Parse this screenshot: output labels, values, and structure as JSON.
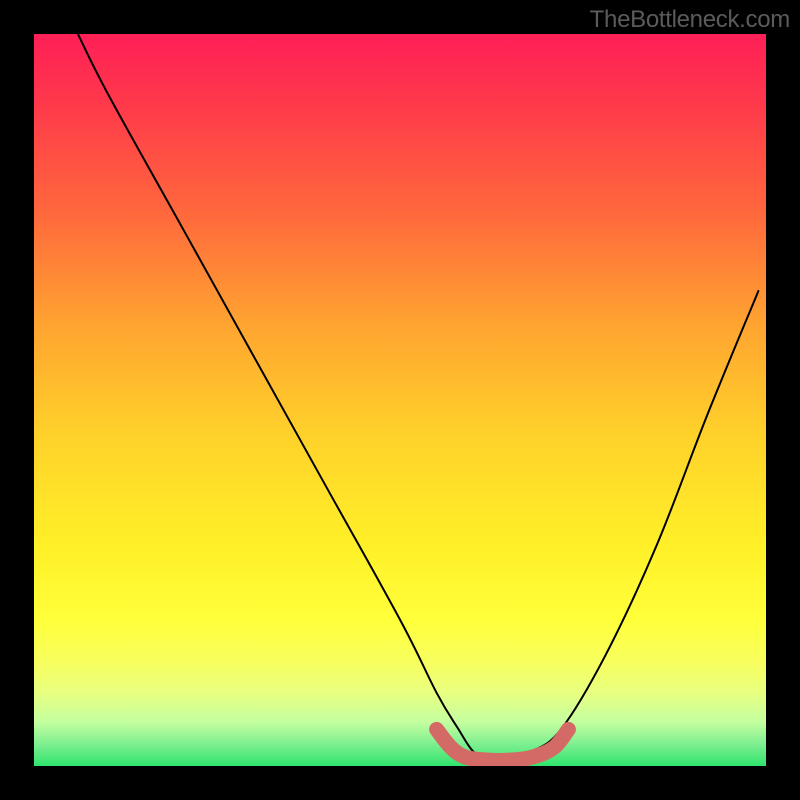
{
  "watermark": "TheBottleneck.com",
  "chart_data": {
    "type": "line",
    "title": "",
    "xlabel": "",
    "ylabel": "",
    "xlim": [
      0,
      100
    ],
    "ylim": [
      0,
      100
    ],
    "grid": false,
    "series": [
      {
        "name": "bottleneck-curve",
        "x": [
          6,
          10,
          20,
          30,
          40,
          50,
          55,
          58,
          60,
          62,
          65,
          68,
          72,
          78,
          85,
          92,
          99
        ],
        "y": [
          100,
          92,
          74,
          56,
          38,
          20,
          10,
          5,
          2,
          1,
          1,
          2,
          5,
          15,
          30,
          48,
          65
        ]
      },
      {
        "name": "highlighted-minimum",
        "x": [
          55,
          57,
          59,
          62,
          65,
          68,
          71,
          73
        ],
        "y": [
          5,
          2.5,
          1.2,
          0.8,
          0.8,
          1.2,
          2.5,
          5
        ]
      }
    ],
    "gradient_stops": [
      {
        "pos": 0,
        "color": "#ff1f57"
      },
      {
        "pos": 10,
        "color": "#ff3a4a"
      },
      {
        "pos": 25,
        "color": "#ff6a3c"
      },
      {
        "pos": 40,
        "color": "#ffa530"
      },
      {
        "pos": 55,
        "color": "#ffd22a"
      },
      {
        "pos": 70,
        "color": "#fff028"
      },
      {
        "pos": 80,
        "color": "#ffff3a"
      },
      {
        "pos": 86,
        "color": "#f7ff60"
      },
      {
        "pos": 90,
        "color": "#e8ff80"
      },
      {
        "pos": 94,
        "color": "#c4ffa0"
      },
      {
        "pos": 97,
        "color": "#7eef90"
      },
      {
        "pos": 100,
        "color": "#2fe46c"
      }
    ]
  }
}
